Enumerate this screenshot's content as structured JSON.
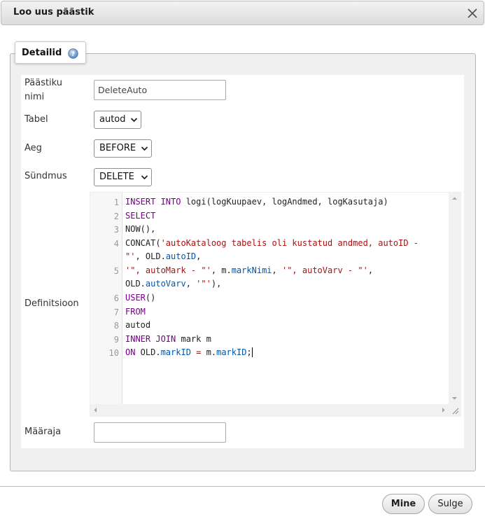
{
  "dialog": {
    "title": "Loo uus päästik",
    "legend": "Detailid"
  },
  "form": {
    "name_label": "Päästiku nimi",
    "name_value": "DeleteAuto",
    "table_label": "Tabel",
    "table_value": "autod",
    "time_label": "Aeg",
    "time_value": "BEFORE",
    "event_label": "Sündmus",
    "event_value": "DELETE",
    "definition_label": "Definitsioon",
    "definer_label": "Määraja",
    "definer_value": ""
  },
  "editor": {
    "line_numbers": [
      "1",
      "2",
      "3",
      "4",
      "5",
      "6",
      "7",
      "8",
      "9",
      "10"
    ]
  },
  "buttons": {
    "go": "Mine",
    "close": "Sulge"
  },
  "colors": {
    "keyword": "#770088",
    "string": "#aa1111",
    "property": "#0055aa",
    "dialog_bg": "#f0f0f0"
  },
  "icons": {
    "close": "close-icon",
    "help": "help-icon",
    "dropdown": "chevron-down-icon"
  }
}
